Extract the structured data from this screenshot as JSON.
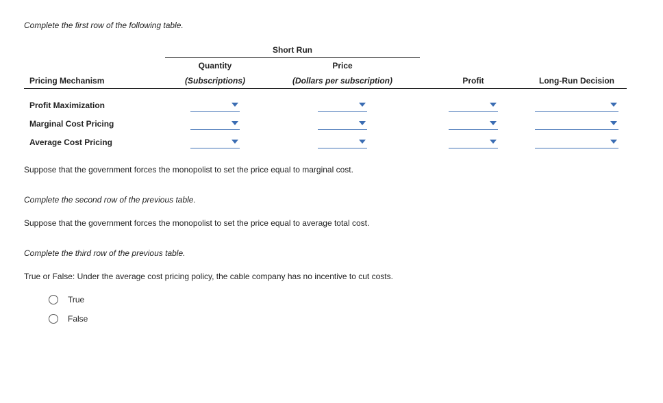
{
  "instruction1": "Complete the first row of the following table.",
  "table": {
    "short_run_header": "Short Run",
    "col_mechanism": "Pricing Mechanism",
    "col_quantity": "Quantity",
    "col_quantity_sub": "(Subscriptions)",
    "col_price": "Price",
    "col_price_sub": "(Dollars per subscription)",
    "col_profit": "Profit",
    "col_longrun": "Long-Run Decision",
    "rows": [
      {
        "label": "Profit Maximization"
      },
      {
        "label": "Marginal Cost Pricing"
      },
      {
        "label": "Average Cost Pricing"
      }
    ]
  },
  "para1": "Suppose that the government forces the monopolist to set the price equal to marginal cost.",
  "instruction2": "Complete the second row of the previous table.",
  "para2": "Suppose that the government forces the monopolist to set the price equal to average total cost.",
  "instruction3": "Complete the third row of the previous table.",
  "tf_prompt": "True or False: Under the average cost pricing policy, the cable company has no incentive to cut costs.",
  "opt_true": "True",
  "opt_false": "False"
}
